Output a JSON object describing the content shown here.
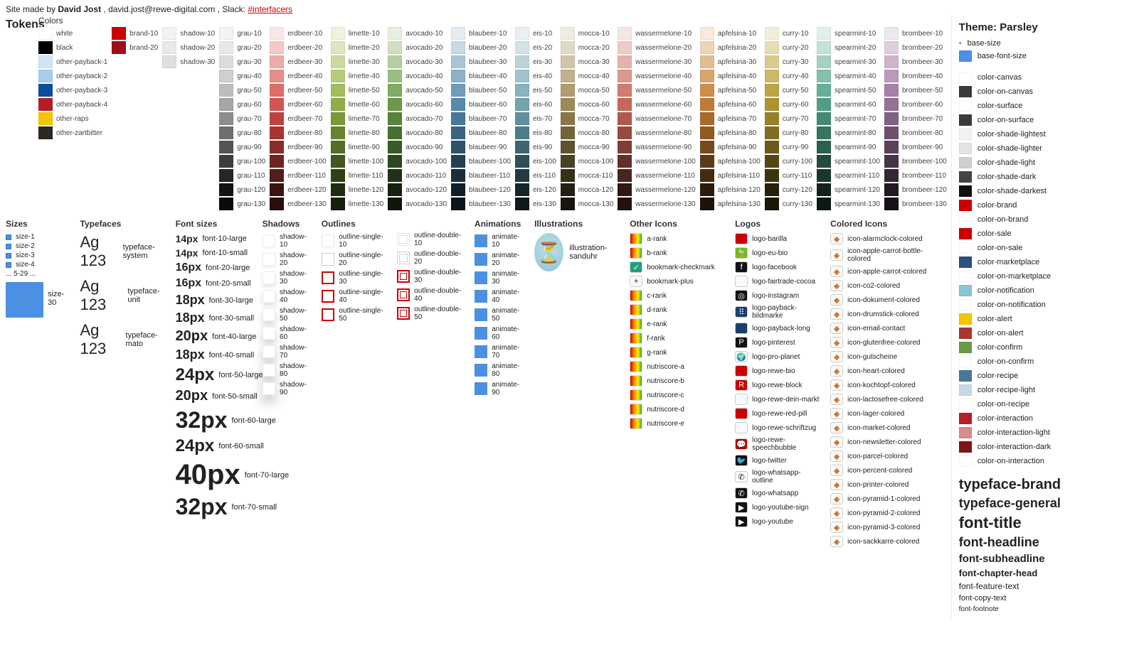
{
  "header": {
    "prefix": "Site made by ",
    "author": "David Jost",
    "email_sep": ", ",
    "email": "david.jost@rewe-digital.com",
    "slack_sep": ", Slack: ",
    "slack_link": "#interfacers"
  },
  "tokens_title": "Tokens",
  "colors_head": "Colors",
  "color_columns": {
    "base": [
      {
        "label": "white",
        "hex": "#ffffff"
      },
      {
        "label": "black",
        "hex": "#000000"
      },
      {
        "label": "other-payback-1",
        "hex": "#cfe5f6"
      },
      {
        "label": "other-payback-2",
        "hex": "#a6cdee"
      },
      {
        "label": "other-payback-3",
        "hex": "#0e4ea0"
      },
      {
        "label": "other-payback-4",
        "hex": "#b22025"
      },
      {
        "label": "other-raps",
        "hex": "#f2c600"
      },
      {
        "label": "other-zartbitter",
        "hex": "#2e2823"
      }
    ],
    "brand": [
      {
        "label": "brand-10",
        "hex": "#cc0000"
      },
      {
        "label": "brand-20",
        "hex": "#9f0f18"
      }
    ],
    "shadow": [
      {
        "label": "shadow-10",
        "hex": "#f2f2f2"
      },
      {
        "label": "shadow-20",
        "hex": "#e9e9e9"
      },
      {
        "label": "shadow-30",
        "hex": "#e0e0e0"
      }
    ],
    "families": [
      {
        "name": "grau",
        "hues": [
          "#f4f4f4",
          "#e8e8e8",
          "#dcdcdc",
          "#cfcfcf",
          "#bdbdbd",
          "#a6a6a6",
          "#8d8d8d",
          "#6f6f6f",
          "#555555",
          "#3d3d3d",
          "#262626",
          "#141414",
          "#0a0a0a"
        ]
      },
      {
        "name": "erdbeer",
        "hues": [
          "#fae6e5",
          "#f4c9c7",
          "#eeaba8",
          "#e88d89",
          "#df6e6a",
          "#d15551",
          "#bf413e",
          "#a63632",
          "#8a2d29",
          "#6f2421",
          "#551c1a",
          "#3b1312",
          "#2a0d0c"
        ]
      },
      {
        "name": "limette",
        "hues": [
          "#edf2dc",
          "#dde6be",
          "#cbd99e",
          "#b7cb7c",
          "#a4bd5d",
          "#90ad46",
          "#7b9a38",
          "#678530",
          "#546f28",
          "#425820",
          "#304118",
          "#202c10",
          "#161f0b"
        ]
      },
      {
        "name": "avocado",
        "hues": [
          "#e7efe0",
          "#cfe0c2",
          "#b5cfa2",
          "#9abd81",
          "#80ab62",
          "#6a994a",
          "#58843c",
          "#487031",
          "#3a5b28",
          "#2d471f",
          "#203317",
          "#15220f",
          "#0e170a"
        ]
      },
      {
        "name": "blaubeer",
        "hues": [
          "#e3ecf2",
          "#c7d9e5",
          "#aac5d7",
          "#8cb1c9",
          "#6e9cba",
          "#578aab",
          "#477898",
          "#3a6582",
          "#2f526a",
          "#244053",
          "#1a2f3d",
          "#101f28",
          "#0b151b"
        ]
      },
      {
        "name": "eis",
        "hues": [
          "#e9f0f2",
          "#d3e2e6",
          "#bbd3d9",
          "#a2c3cb",
          "#89b3bd",
          "#73a3af",
          "#5f919e",
          "#4e7d88",
          "#3f6670",
          "#305058",
          "#223a40",
          "#15262a",
          "#0e191c"
        ]
      },
      {
        "name": "mocca",
        "hues": [
          "#f0ece3",
          "#e1d9c7",
          "#d1c5aa",
          "#c0b18c",
          "#af9c6f",
          "#9d8958",
          "#897746",
          "#746538",
          "#5f532d",
          "#4a4123",
          "#362f1a",
          "#231f11",
          "#18150c"
        ]
      },
      {
        "name": "wassermelone",
        "hues": [
          "#f7e6e4",
          "#efccc8",
          "#e6b2ab",
          "#dc978e",
          "#d17c71",
          "#c5685c",
          "#b2574b",
          "#994a40",
          "#7e3d35",
          "#64302a",
          "#4a241f",
          "#311815",
          "#22110f"
        ]
      },
      {
        "name": "apfelsina",
        "hues": [
          "#f6eadb",
          "#edd4b6",
          "#e3bd91",
          "#d8a56c",
          "#cd8e4a",
          "#bf7b33",
          "#a96a2a",
          "#905a24",
          "#764a1d",
          "#5c3a17",
          "#432a11",
          "#2b1b0b",
          "#1e1308"
        ]
      },
      {
        "name": "curry",
        "hues": [
          "#f3eeda",
          "#e7dcb4",
          "#dacb8d",
          "#ccb866",
          "#bea543",
          "#ae932f",
          "#998126",
          "#826e20",
          "#6b5a1a",
          "#544714",
          "#3d330f",
          "#27210a",
          "#1b1707"
        ]
      },
      {
        "name": "spearmint",
        "hues": [
          "#e1f0eb",
          "#c3e1d7",
          "#a4d1c2",
          "#85c1ad",
          "#67b098",
          "#519e86",
          "#428a74",
          "#367561",
          "#2c604f",
          "#224b3e",
          "#19372d",
          "#10241d",
          "#0b1914"
        ]
      },
      {
        "name": "brombeer",
        "hues": [
          "#efe7ee",
          "#dfcede",
          "#cdb4cc",
          "#bb9abb",
          "#a881a9",
          "#957097",
          "#826084",
          "#6e516f",
          "#5a425b",
          "#473447",
          "#342634",
          "#221922",
          "#181218"
        ]
      }
    ],
    "family_steps": [
      "10",
      "20",
      "30",
      "40",
      "50",
      "60",
      "70",
      "80",
      "90",
      "100",
      "110",
      "120",
      "130"
    ]
  },
  "sidebar": {
    "title": "Theme: Parsley",
    "base": [
      {
        "label": "base-size",
        "sw": "#ffffff",
        "dot": true
      },
      {
        "label": "base-font-size",
        "sw": "#4b90e2"
      }
    ],
    "tokens": [
      {
        "label": "color-canvas",
        "sw": "#ffffff"
      },
      {
        "label": "color-on-canvas",
        "sw": "#3a3a3a"
      },
      {
        "label": "color-surface",
        "sw": "#ffffff"
      },
      {
        "label": "color-on-surface",
        "sw": "#3a3a3a"
      },
      {
        "label": "color-shade-lightest",
        "sw": "#f2f2f2"
      },
      {
        "label": "color-shade-lighter",
        "sw": "#e4e4e4"
      },
      {
        "label": "color-shade-light",
        "sw": "#cfcfcf"
      },
      {
        "label": "color-shade-dark",
        "sw": "#444444"
      },
      {
        "label": "color-shade-darkest",
        "sw": "#111111"
      },
      {
        "label": "color-brand",
        "sw": "#cc0000"
      },
      {
        "label": "color-on-brand",
        "sw": "#ffffff"
      },
      {
        "label": "color-sale",
        "sw": "#cc0000"
      },
      {
        "label": "color-on-sale",
        "sw": "#ffffff"
      },
      {
        "label": "color-marketplace",
        "sw": "#2c4f7c"
      },
      {
        "label": "color-on-marketplace",
        "sw": "#ffffff"
      },
      {
        "label": "color-notification",
        "sw": "#8bc5d5"
      },
      {
        "label": "color-on-notification",
        "sw": "#ffffff"
      },
      {
        "label": "color-alert",
        "sw": "#f2c600"
      },
      {
        "label": "color-on-alert",
        "sw": "#a63632"
      },
      {
        "label": "color-confirm",
        "sw": "#6a994a"
      },
      {
        "label": "color-on-confirm",
        "sw": "#ffffff"
      },
      {
        "label": "color-recipe",
        "sw": "#477898"
      },
      {
        "label": "color-recipe-light",
        "sw": "#c7d9e5"
      },
      {
        "label": "color-on-recipe",
        "sw": "#ffffff"
      },
      {
        "label": "color-interaction",
        "sw": "#b22025"
      },
      {
        "label": "color-interaction-light",
        "sw": "#d88b8d"
      },
      {
        "label": "color-interaction-dark",
        "sw": "#7c1618"
      },
      {
        "label": "color-on-interaction",
        "sw": "#ffffff"
      }
    ],
    "type": [
      {
        "label": "typeface-brand",
        "cls": "t1"
      },
      {
        "label": "typeface-general",
        "cls": "t2"
      },
      {
        "label": "font-title",
        "cls": "t3"
      },
      {
        "label": "font-headline",
        "cls": "t4"
      },
      {
        "label": "font-subheadline",
        "cls": "t5"
      },
      {
        "label": "font-chapter-head",
        "cls": "t6"
      },
      {
        "label": "font-feature-text",
        "cls": "t7"
      },
      {
        "label": "font-copy-text",
        "cls": "t8"
      },
      {
        "label": "font-footnote",
        "cls": "t9"
      }
    ]
  },
  "sizes": {
    "head": "Sizes",
    "items": [
      "size-1",
      "size-2",
      "size-3",
      "size-4"
    ],
    "ellipsis": "... 5-29 ...",
    "big_label": "size-30"
  },
  "typefaces": {
    "head": "Typefaces",
    "sample": "Ag 123",
    "items": [
      "typeface-system",
      "typeface-unit",
      "typeface-mato"
    ]
  },
  "fontsizes": {
    "head": "Font sizes",
    "rows": [
      {
        "px": "14px",
        "label": "font-10-large"
      },
      {
        "px": "14px",
        "label": "font-10-small"
      },
      {
        "px": "16px",
        "label": "font-20-large"
      },
      {
        "px": "16px",
        "label": "font-20-small"
      },
      {
        "px": "18px",
        "label": "font-30-large"
      },
      {
        "px": "18px",
        "label": "font-30-small"
      },
      {
        "px": "20px",
        "label": "font-40-large"
      },
      {
        "px": "18px",
        "label": "font-40-small"
      },
      {
        "px": "24px",
        "label": "font-50-large"
      },
      {
        "px": "20px",
        "label": "font-50-small"
      },
      {
        "px": "32px",
        "label": "font-60-large"
      },
      {
        "px": "24px",
        "label": "font-60-small"
      },
      {
        "px": "40px",
        "label": "font-70-large"
      },
      {
        "px": "32px",
        "label": "font-70-small"
      }
    ]
  },
  "shadows": {
    "head": "Shadows",
    "items": [
      "shadow-10",
      "shadow-20",
      "shadow-30",
      "shadow-40",
      "shadow-50",
      "shadow-60",
      "shadow-70",
      "shadow-80",
      "shadow-90"
    ]
  },
  "outlines": {
    "head": "Outlines",
    "single": [
      "outline-single-10",
      "outline-single-20",
      "outline-single-30",
      "outline-single-40",
      "outline-single-50"
    ],
    "double": [
      "outline-double-10",
      "outline-double-20",
      "outline-double-30",
      "outline-double-40",
      "outline-double-50"
    ],
    "single_colors": [
      "#e4e4e4",
      "#cfcfcf",
      "#cc0000",
      "#cc0000",
      "#cc0000"
    ],
    "double_colors": [
      "#e4e4e4",
      "#cfcfcf",
      "#cc0000",
      "#cc0000",
      "#cc0000"
    ]
  },
  "animations": {
    "head": "Animations",
    "items": [
      "animate-10",
      "animate-20",
      "animate-30",
      "animate-40",
      "animate-50",
      "animate-60",
      "animate-70",
      "animate-80",
      "animate-90"
    ]
  },
  "illustrations": {
    "head": "Illustrations",
    "item": "illustration-sanduhr",
    "emoji": "⏳"
  },
  "other_icons": {
    "head": "Other Icons",
    "items": [
      {
        "label": "a-rank",
        "cls": "ico-sw"
      },
      {
        "label": "b-rank",
        "cls": "ico-sw"
      },
      {
        "label": "bookmark-checkmark",
        "cls": "ico-plain ico-teal",
        "glyph": "✓"
      },
      {
        "label": "bookmark-plus",
        "cls": "ico-plain",
        "glyph": "+"
      },
      {
        "label": "c-rank",
        "cls": "ico-sw"
      },
      {
        "label": "d-rank",
        "cls": "ico-sw"
      },
      {
        "label": "e-rank",
        "cls": "ico-sw"
      },
      {
        "label": "f-rank",
        "cls": "ico-sw"
      },
      {
        "label": "g-rank",
        "cls": "ico-sw"
      },
      {
        "label": "nutriscore-a",
        "cls": "ico-sw"
      },
      {
        "label": "nutriscore-b",
        "cls": "ico-sw"
      },
      {
        "label": "nutriscore-c",
        "cls": "ico-sw"
      },
      {
        "label": "nutriscore-d",
        "cls": "ico-sw"
      },
      {
        "label": "nutriscore-e",
        "cls": "ico-sw"
      }
    ]
  },
  "logos": {
    "head": "Logos",
    "items": [
      {
        "label": "logo-barilla",
        "cls": "ico-plain ico-red"
      },
      {
        "label": "logo-eu-bio",
        "cls": "ico-plain",
        "glyph": "🍃",
        "style": "background:#7ab51d;color:#fff;"
      },
      {
        "label": "logo-facebook",
        "cls": "ico-plain ico-dark",
        "glyph": "f"
      },
      {
        "label": "logo-fairtrade-cocoa",
        "cls": "ico-plain"
      },
      {
        "label": "logo-instagram",
        "cls": "ico-plain ico-dark",
        "glyph": "◎"
      },
      {
        "label": "logo-payback-bildmarke",
        "cls": "ico-plain ico-blue",
        "glyph": "⠿"
      },
      {
        "label": "logo-payback-long",
        "cls": "ico-plain ico-blue"
      },
      {
        "label": "logo-pinterest",
        "cls": "ico-plain ico-dark",
        "glyph": "P"
      },
      {
        "label": "logo-pro-planet",
        "cls": "ico-plain",
        "glyph": "🌍"
      },
      {
        "label": "logo-rewe-bio",
        "cls": "ico-plain ico-red"
      },
      {
        "label": "logo-rewe-block",
        "cls": "ico-plain ico-red",
        "glyph": "R"
      },
      {
        "label": "logo-rewe-dein-markt",
        "cls": "ico-plain"
      },
      {
        "label": "logo-rewe-red-pill",
        "cls": "ico-plain ico-red"
      },
      {
        "label": "logo-rewe-schriftzug",
        "cls": "ico-plain"
      },
      {
        "label": "logo-rewe-speechbubble",
        "cls": "ico-plain ico-red",
        "glyph": "💬"
      },
      {
        "label": "logo-twitter",
        "cls": "ico-plain ico-dark",
        "glyph": "🐦"
      },
      {
        "label": "logo-whatsapp-outline",
        "cls": "ico-plain",
        "glyph": "✆"
      },
      {
        "label": "logo-whatsapp",
        "cls": "ico-plain ico-dark",
        "glyph": "✆"
      },
      {
        "label": "logo-youtube-sign",
        "cls": "ico-plain ico-dark",
        "glyph": "▶"
      },
      {
        "label": "logo-youtube",
        "cls": "ico-plain ico-dark",
        "glyph": "▶"
      }
    ]
  },
  "colored_icons": {
    "head": "Colored Icons",
    "items": [
      "icon-alarmclock-colored",
      "icon-apple-carrot-bottle-colored",
      "icon-apple-carrot-colored",
      "icon-co2-colored",
      "icon-dokument-colored",
      "icon-drumstick-colored",
      "icon-email-contact",
      "icon-glutenfree-colored",
      "icon-gutscheine",
      "icon-heart-colored",
      "icon-kochtopf-colored",
      "icon-lactosefree-colored",
      "icon-lager-colored",
      "icon-market-colored",
      "icon-newsletter-colored",
      "icon-parcel-colored",
      "icon-percent-colored",
      "icon-printer-colored",
      "icon-pyramid-1-colored",
      "icon-pyramid-2-colored",
      "icon-pyramid-3-colored",
      "icon-sackkarre-colored"
    ]
  }
}
